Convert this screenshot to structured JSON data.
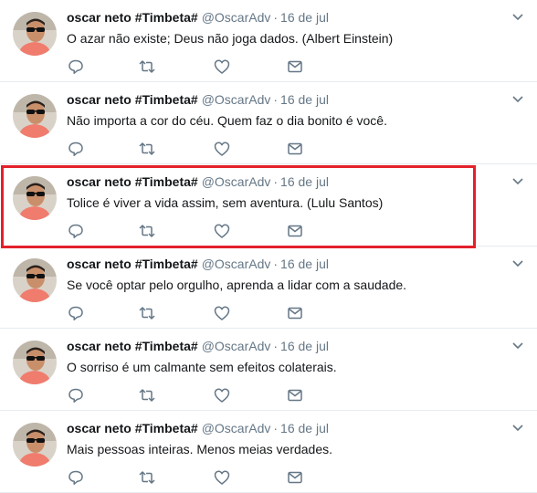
{
  "tweets": [
    {
      "name": "oscar neto #Timbeta#",
      "handle": "@OscarAdv",
      "separator": "·",
      "time": "16 de jul",
      "text": "O azar não existe; Deus não joga dados. (Albert Einstein)"
    },
    {
      "name": "oscar neto #Timbeta#",
      "handle": "@OscarAdv",
      "separator": "·",
      "time": "16 de jul",
      "text": "Não importa a cor do céu. Quem faz o dia bonito é você."
    },
    {
      "name": "oscar neto #Timbeta#",
      "handle": "@OscarAdv",
      "separator": "·",
      "time": "16 de jul",
      "text": "Tolice é viver a vida assim, sem aventura. (Lulu Santos)"
    },
    {
      "name": "oscar neto #Timbeta#",
      "handle": "@OscarAdv",
      "separator": "·",
      "time": "16 de jul",
      "text": "Se você optar pelo orgulho, aprenda a lidar com a saudade."
    },
    {
      "name": "oscar neto #Timbeta#",
      "handle": "@OscarAdv",
      "separator": "·",
      "time": "16 de jul",
      "text": "O sorriso é um calmante sem efeitos colaterais."
    },
    {
      "name": "oscar neto #Timbeta#",
      "handle": "@OscarAdv",
      "separator": "·",
      "time": "16 de jul",
      "text": "Mais pessoas inteiras. Menos meias verdades."
    }
  ],
  "icons": {
    "reply": "reply-icon",
    "retweet": "retweet-icon",
    "like": "heart-icon",
    "dm": "envelope-icon",
    "caret": "chevron-down-icon"
  },
  "colors": {
    "icon": "#657786",
    "highlight_border": "#e3212b",
    "divider": "#e6ecf0"
  },
  "highlighted_tweet_index": 2
}
